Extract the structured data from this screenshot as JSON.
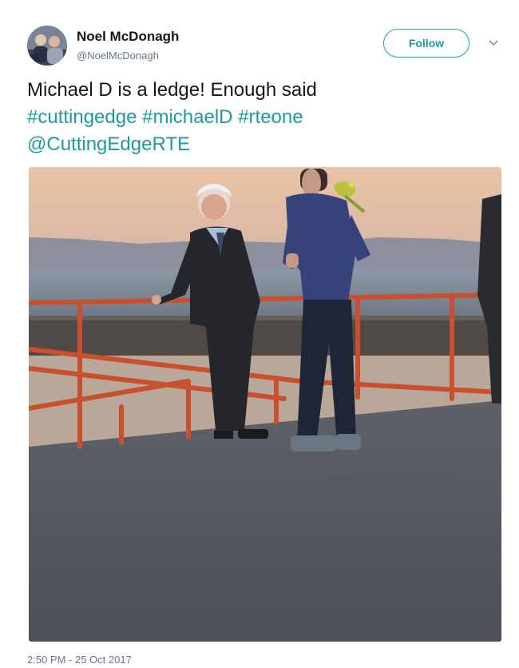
{
  "author": {
    "name": "Noel McDonagh",
    "handle": "@NoelMcDonagh"
  },
  "follow_label": "Follow",
  "tweet": {
    "text": "Michael D is a ledge! Enough said",
    "hashtags": [
      "#cuttingedge",
      "#michaelD",
      "#rteone"
    ],
    "mention": "@CuttingEdgeRTE"
  },
  "timestamp": "2:50 PM - 25 Oct 2017",
  "icons": {
    "more": "chevron-down-icon"
  },
  "colors": {
    "accent": "#1d9aa0",
    "secondary_text": "#657786",
    "primary_text": "#14171a"
  }
}
